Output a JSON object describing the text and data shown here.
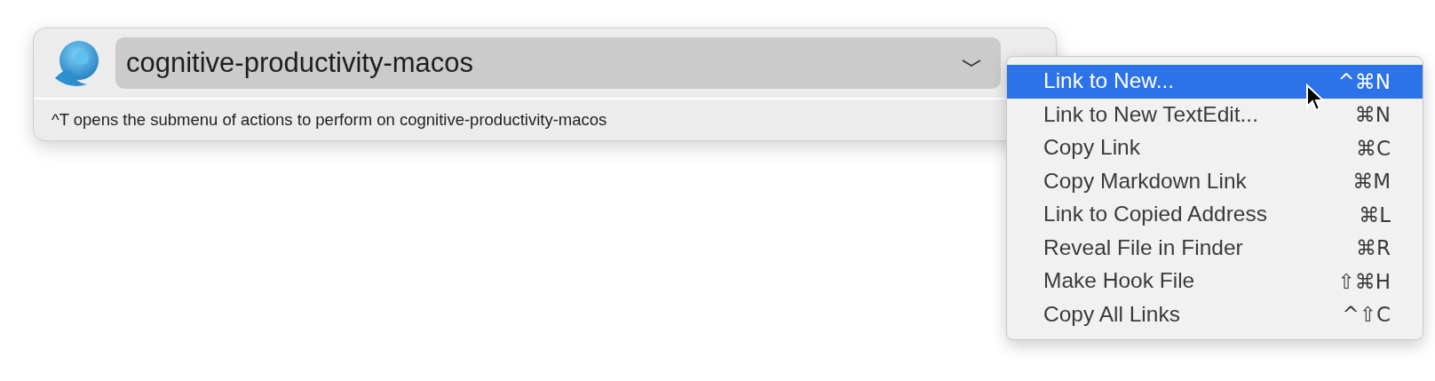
{
  "query": {
    "value": "cognitive-productivity-macos"
  },
  "status_bar": {
    "text": "^T opens the submenu of actions to perform on cognitive-productivity-macos"
  },
  "menu": {
    "items": [
      {
        "label": "Link to New...",
        "shortcut": "^⌘N",
        "selected": true
      },
      {
        "label": "Link to New TextEdit...",
        "shortcut": "⌘N",
        "selected": false
      },
      {
        "label": "Copy Link",
        "shortcut": "⌘C",
        "selected": false
      },
      {
        "label": "Copy Markdown Link",
        "shortcut": "⌘M",
        "selected": false
      },
      {
        "label": "Link to Copied Address",
        "shortcut": "⌘L",
        "selected": false
      },
      {
        "label": "Reveal File in Finder",
        "shortcut": "⌘R",
        "selected": false
      },
      {
        "label": "Make Hook File",
        "shortcut": "⇧⌘H",
        "selected": false
      },
      {
        "label": "Copy All Links",
        "shortcut": "^⇧C",
        "selected": false
      }
    ]
  }
}
